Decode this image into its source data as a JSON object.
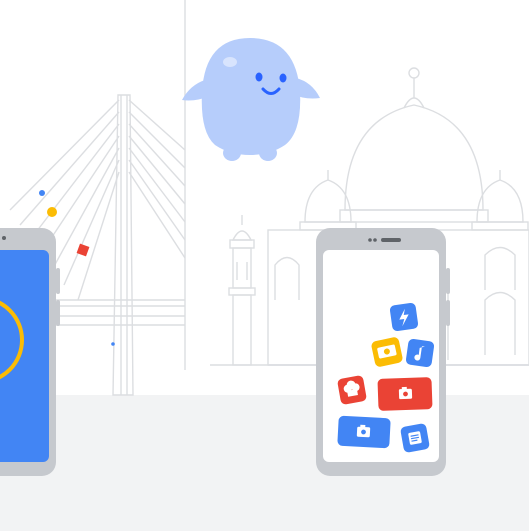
{
  "colors": {
    "background": "#ffffff",
    "floor": "#f1f3f4",
    "line_art": "#dadce0",
    "phone_frame": "#c6c9ce",
    "screen": "#ffffff",
    "blue": "#4285f4",
    "red": "#ea4335",
    "yellow": "#fbbc04",
    "mascot": "#b6cdfb",
    "mascot_face": "#2962ff"
  },
  "icons": {
    "lightning": "lightning-icon",
    "music": "music-note-icon",
    "money": "money-icon",
    "camera": "camera-icon",
    "chef": "chef-hat-icon",
    "notes": "notes-icon"
  }
}
